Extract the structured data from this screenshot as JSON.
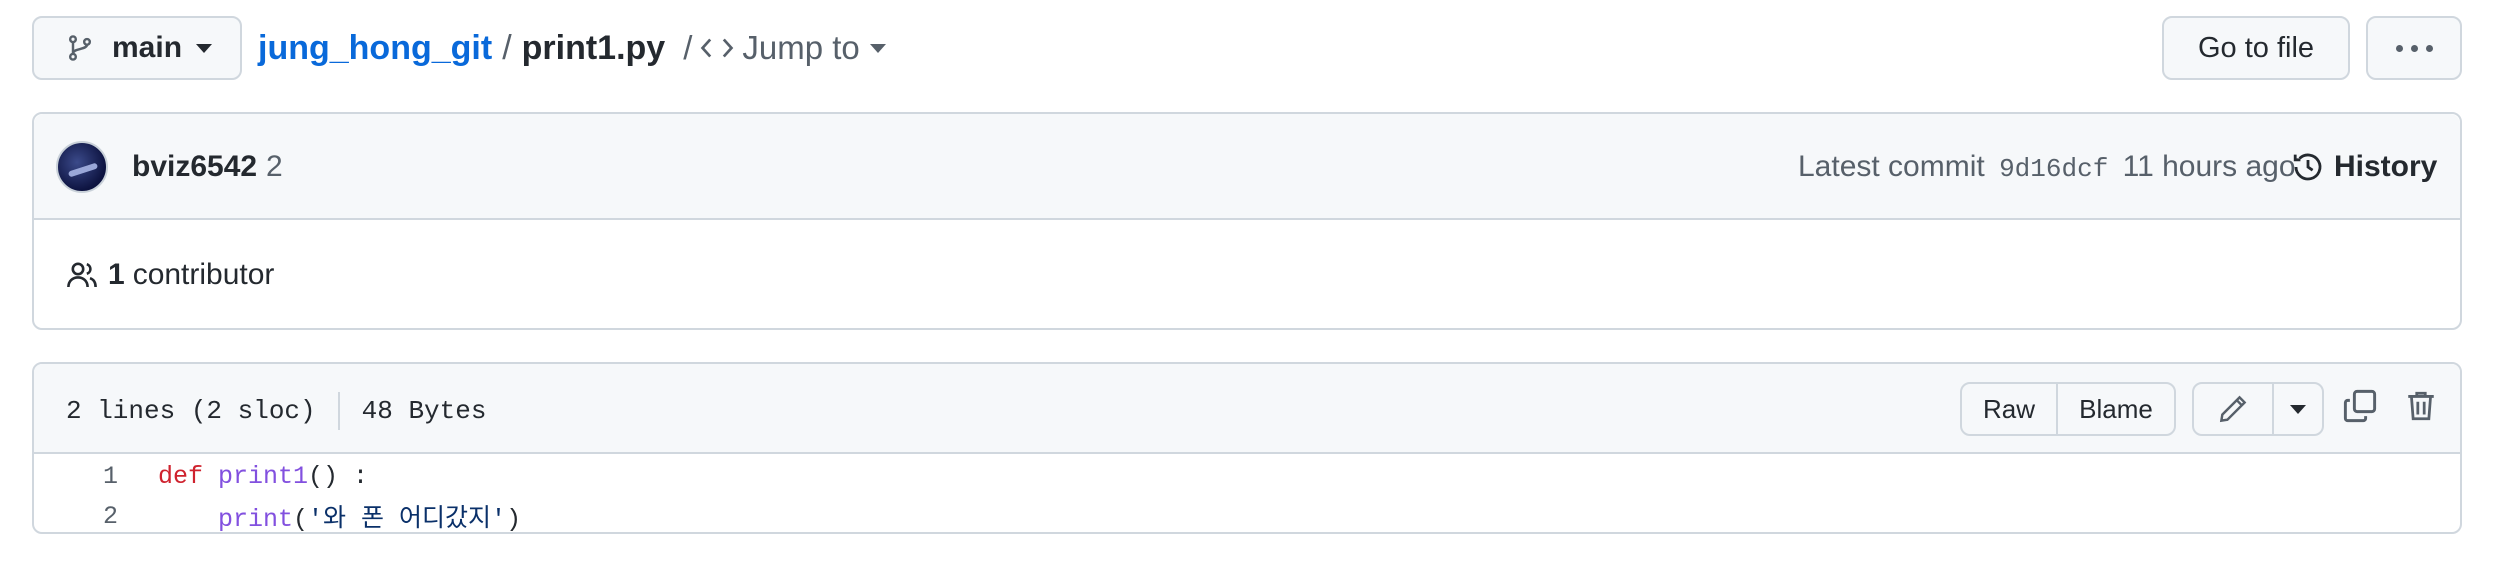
{
  "topbar": {
    "branch": "main",
    "repo": "jung_hong_git",
    "separator": "/",
    "file": "print1.py",
    "jump_slash": "/",
    "jump_label": "Jump to",
    "go_to_file": "Go to file"
  },
  "commit": {
    "author": "bviz6542",
    "author_count": "2",
    "latest_label": "Latest commit",
    "sha": "9d16dcf",
    "time": "11 hours ago",
    "history": "History",
    "contributors_count": "1",
    "contributors_label": "contributor"
  },
  "file": {
    "lines_info": "2 lines (2 sloc)",
    "size": "48 Bytes",
    "raw": "Raw",
    "blame": "Blame",
    "code_lines": [
      {
        "num": "1",
        "kw": "def",
        "fn": "print1",
        "rest": "() :"
      },
      {
        "num": "2",
        "indent": "    ",
        "fn": "print",
        "open": "(",
        "str": "'와 폰 어디갔지'",
        "close": ")"
      }
    ]
  },
  "icons": [
    "branch-icon",
    "code-icon",
    "history-icon",
    "people-icon",
    "pencil-icon",
    "copy-icon",
    "trash-icon",
    "kebab-icon"
  ],
  "colors": {
    "link": "#0969da",
    "keyword": "#cf222e",
    "function": "#8250df",
    "string": "#0a3069",
    "border": "#d0d7de",
    "header_bg": "#f6f8fa"
  }
}
